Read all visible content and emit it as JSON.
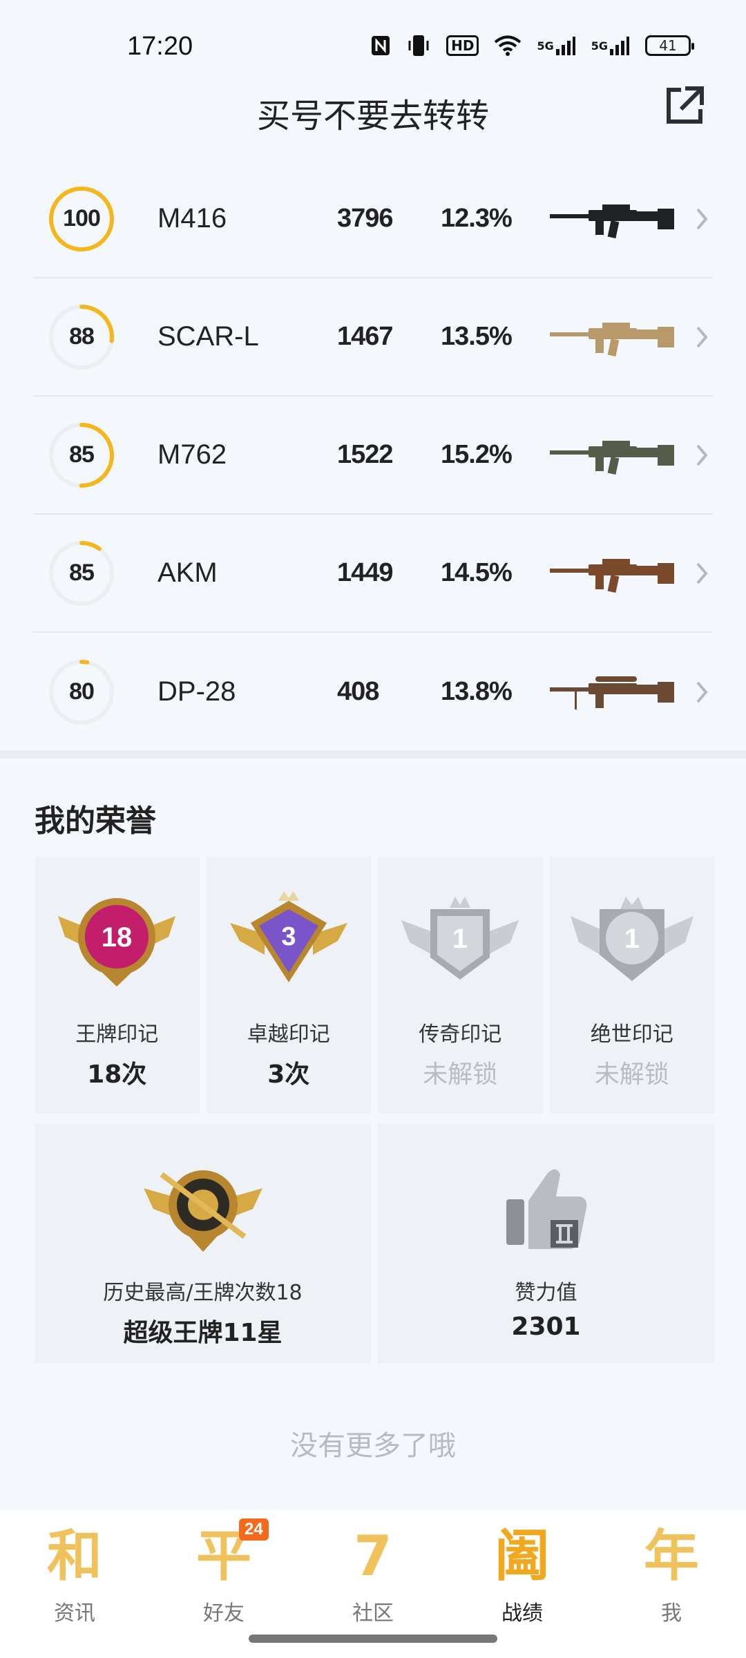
{
  "status_bar": {
    "time": "17:20",
    "icons": [
      "nfc-icon",
      "vibrate-icon",
      "hd-icon",
      "wifi-icon",
      "signal-5g-icon",
      "signal-5g-icon"
    ],
    "hd_text": "HD",
    "signal_text": "5G",
    "battery": "41"
  },
  "header": {
    "title": "买号不要去转转",
    "share_icon": "share-icon"
  },
  "weapons": [
    {
      "score": "100",
      "score_fraction": 1.0,
      "name": "M416",
      "kills": "3796",
      "rate": "12.3%",
      "color": "#1f2326"
    },
    {
      "score": "88",
      "score_fraction": 0.27,
      "name": "SCAR-L",
      "kills": "1467",
      "rate": "13.5%",
      "color": "#b89a6a"
    },
    {
      "score": "85",
      "score_fraction": 0.5,
      "name": "M762",
      "kills": "1522",
      "rate": "15.2%",
      "color": "#555c4a"
    },
    {
      "score": "85",
      "score_fraction": 0.1,
      "name": "AKM",
      "kills": "1449",
      "rate": "14.5%",
      "color": "#7a4a2a"
    },
    {
      "score": "80",
      "score_fraction": 0.03,
      "name": "DP-28",
      "kills": "408",
      "rate": "13.8%",
      "color": "#6b4a33"
    }
  ],
  "honor": {
    "title": "我的荣誉",
    "cards": [
      {
        "label": "王牌印记",
        "value": "18次",
        "locked": false,
        "badge_number": "18",
        "badge_color": "#c21e6b"
      },
      {
        "label": "卓越印记",
        "value": "3次",
        "locked": false,
        "badge_number": "3",
        "badge_color": "#7a55c9"
      },
      {
        "label": "传奇印记",
        "value": "未解锁",
        "locked": true,
        "badge_number": "1",
        "badge_color": "#9aa0a6"
      },
      {
        "label": "绝世印记",
        "value": "未解锁",
        "locked": true,
        "badge_number": "1",
        "badge_color": "#9aa0a6"
      }
    ],
    "wide_cards": [
      {
        "label": "历史最高/王牌次数18",
        "value": "超级王牌11星",
        "icon": "rank-emblem-icon"
      },
      {
        "label": "赞力值",
        "value": "2301",
        "icon": "thumbs-up-icon"
      }
    ]
  },
  "footer_note": "没有更多了哦",
  "bottom_nav": {
    "items": [
      {
        "glyph": "和",
        "label": "资讯",
        "active": false
      },
      {
        "glyph": "平",
        "label": "好友",
        "active": false,
        "badge": "24"
      },
      {
        "glyph": "7",
        "label": "社区",
        "active": false
      },
      {
        "glyph": "阖",
        "label": "战绩",
        "active": true
      },
      {
        "glyph": "年",
        "label": "我",
        "active": false
      }
    ]
  },
  "colors": {
    "accent": "#f5b61c",
    "ring_track": "#eceef1",
    "background": "#f4f7fb"
  }
}
